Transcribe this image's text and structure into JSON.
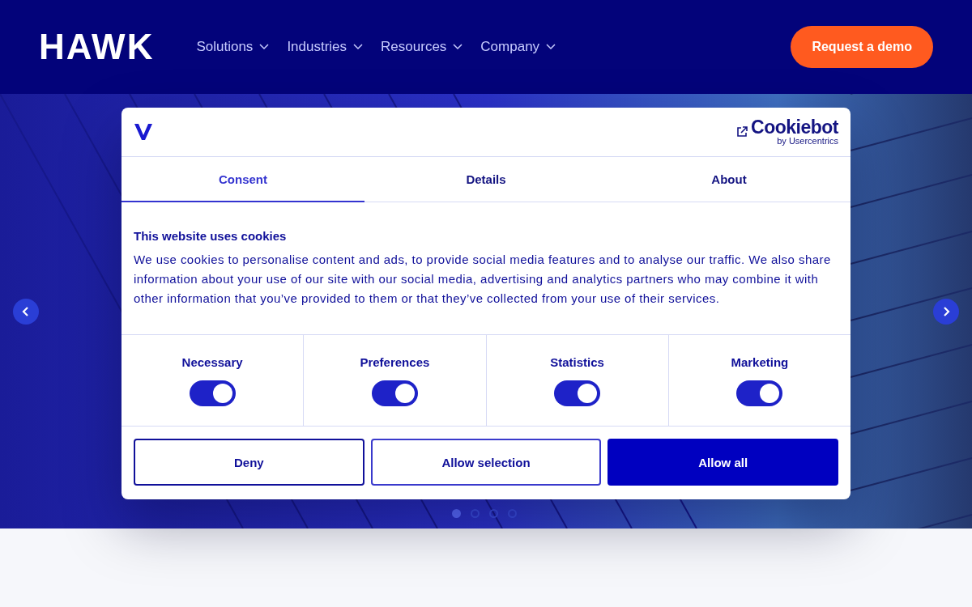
{
  "header": {
    "logo": "HAWK",
    "nav": [
      {
        "label": "Solutions"
      },
      {
        "label": "Industries"
      },
      {
        "label": "Resources"
      },
      {
        "label": "Company"
      }
    ],
    "cta": "Request a demo"
  },
  "hero": {
    "dots": [
      {
        "selected": true
      },
      {
        "selected": false
      },
      {
        "selected": false
      },
      {
        "selected": false
      }
    ]
  },
  "dialog": {
    "brand": "Cookiebot",
    "brand_sub": "by Usercentrics",
    "tabs": [
      {
        "label": "Consent",
        "selected": true
      },
      {
        "label": "Details",
        "selected": false
      },
      {
        "label": "About",
        "selected": false
      }
    ],
    "heading": "This website uses cookies",
    "body": "We use cookies to personalise content and ads, to provide social media features and to analyse our traffic. We also share information about your use of our site with our social media, advertising and analytics partners who may combine it with other information that you’ve provided to them or that they’ve collected from your use of their services.",
    "categories": [
      {
        "label": "Necessary",
        "checked": true
      },
      {
        "label": "Preferences",
        "checked": true
      },
      {
        "label": "Statistics",
        "checked": true
      },
      {
        "label": "Marketing",
        "checked": true
      }
    ],
    "buttons": [
      {
        "label": "Deny",
        "kind": "outline"
      },
      {
        "label": "Allow selection",
        "kind": "outline"
      },
      {
        "label": "Allow all",
        "kind": "primary"
      }
    ]
  }
}
